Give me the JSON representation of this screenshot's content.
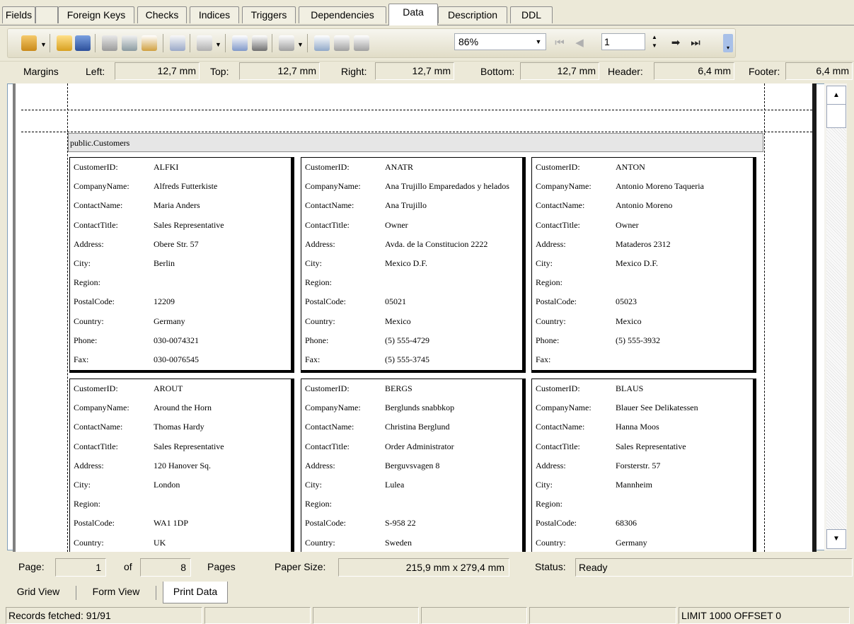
{
  "tabs": [
    "Fields",
    "Foreign Keys",
    "Checks",
    "Indices",
    "Triggers",
    "Dependencies",
    "Data",
    "Description",
    "DDL"
  ],
  "toolbar": {
    "zoom": "86%",
    "page": "1"
  },
  "margins": {
    "title": "Margins",
    "left_label": "Left:",
    "left": "12,7 mm",
    "top_label": "Top:",
    "top": "12,7 mm",
    "right_label": "Right:",
    "right": "12,7 mm",
    "bottom_label": "Bottom:",
    "bottom": "12,7 mm",
    "header_label": "Header:",
    "header": "6,4 mm",
    "footer_label": "Footer:",
    "footer": "6,4 mm"
  },
  "report": {
    "table_name": "public.Customers",
    "field_labels": [
      "CustomerID:",
      "CompanyName:",
      "ContactName:",
      "ContactTitle:",
      "Address:",
      "City:",
      "Region:",
      "PostalCode:",
      "Country:",
      "Phone:",
      "Fax:"
    ],
    "records": [
      {
        "values": [
          "ALFKI",
          "Alfreds Futterkiste",
          "Maria Anders",
          "Sales Representative",
          "Obere Str. 57",
          "Berlin",
          "",
          "12209",
          "Germany",
          "030-0074321",
          "030-0076545"
        ]
      },
      {
        "values": [
          "ANATR",
          "Ana Trujillo Emparedados y helados",
          "Ana Trujillo",
          "Owner",
          "Avda. de la Constitucion 2222",
          "Mexico D.F.",
          "",
          "05021",
          "Mexico",
          "(5) 555-4729",
          "(5) 555-3745"
        ]
      },
      {
        "values": [
          "ANTON",
          "Antonio Moreno Taqueria",
          "Antonio Moreno",
          "Owner",
          "Mataderos 2312",
          "Mexico D.F.",
          "",
          "05023",
          "Mexico",
          "(5) 555-3932",
          ""
        ]
      },
      {
        "values": [
          "AROUT",
          "Around the Horn",
          "Thomas Hardy",
          "Sales Representative",
          "120 Hanover Sq.",
          "London",
          "",
          "WA1 1DP",
          "UK"
        ]
      },
      {
        "values": [
          "BERGS",
          "Berglunds snabbkop",
          "Christina Berglund",
          "Order Administrator",
          "Berguvsvagen 8",
          "Lulea",
          "",
          "S-958 22",
          "Sweden"
        ]
      },
      {
        "values": [
          "BLAUS",
          "Blauer See Delikatessen",
          "Hanna Moos",
          "Sales Representative",
          "Forsterstr. 57",
          "Mannheim",
          "",
          "68306",
          "Germany"
        ]
      }
    ]
  },
  "pager": {
    "page_label": "Page:",
    "page": "1",
    "of_label": "of",
    "total": "8",
    "pages_label": "Pages",
    "paper_label": "Paper Size:",
    "paper": "215,9 mm x 279,4 mm",
    "status_label": "Status:",
    "status": "Ready"
  },
  "view_tabs": [
    "Grid View",
    "Form View",
    "Print Data"
  ],
  "statusbar": {
    "records": "Records fetched: 91/91",
    "limit": "LIMIT 1000 OFFSET 0"
  }
}
